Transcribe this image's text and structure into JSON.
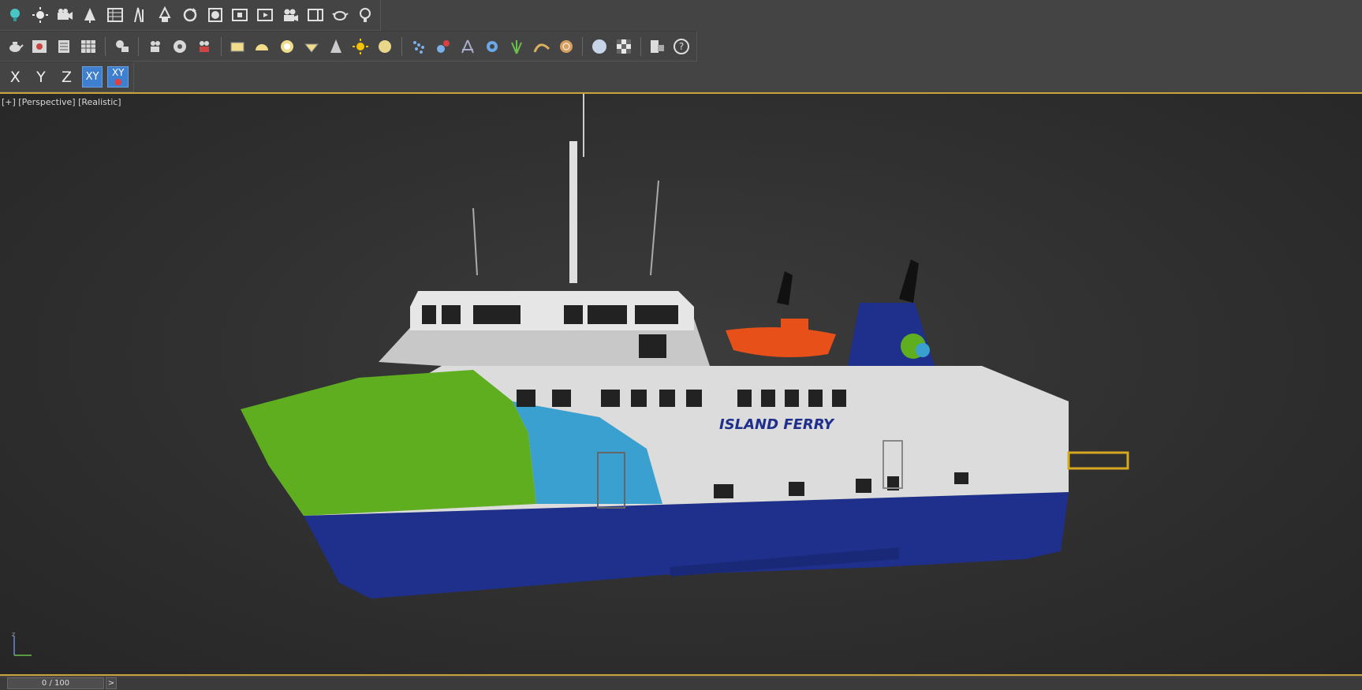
{
  "toolbar_top": {
    "icons": [
      "light-bulb-icon",
      "sun-icon",
      "camera-group-icon",
      "tree-icon",
      "table-icon",
      "stair-icon",
      "tree-node-icon",
      "rotate-icon",
      "material-icon",
      "render-frame-icon",
      "render-window-icon",
      "video-camera-icon",
      "viewport-icon",
      "teapot-icon",
      "bulb-outline-icon"
    ]
  },
  "toolbar_middle": {
    "icons": [
      "teapot-object-icon",
      "render-setup-icon",
      "layer-icon",
      "grid-table-icon",
      "speech-icon",
      "film-camera-icon",
      "sound-icon",
      "render-camera-icon",
      "plane-icon",
      "hemisphere-icon",
      "sphere-ring-icon",
      "geosphere-icon",
      "cone-icon",
      "sun-light-icon",
      "disk-icon",
      "particle-icon",
      "molecule-icon",
      "tripod-icon",
      "gear-icon",
      "grass-icon",
      "hf-terrain-icon",
      "shell-icon",
      "sphere-icon",
      "checker-grid-icon",
      "export-icon",
      "help-icon"
    ]
  },
  "axis_constraints": {
    "x_label": "X",
    "y_label": "Y",
    "z_label": "Z",
    "xy_label": "XY",
    "xy_lock_label": "XY",
    "active": "XY"
  },
  "viewport": {
    "label": "[+] [Perspective] [Realistic]",
    "ship_name": "ISLAND FERRY"
  },
  "timeline": {
    "frame_label": "0 / 100",
    "next_label": ">",
    "current_frame": 0,
    "total_frames": 100
  },
  "colors": {
    "accent": "#c9a23a",
    "active_button": "#3f7fd0",
    "hull_blue": "#1f2f8c",
    "bow_green": "#5fae20",
    "stripe_blue": "#3aa0d0",
    "lifeboat_orange": "#e8501a"
  }
}
